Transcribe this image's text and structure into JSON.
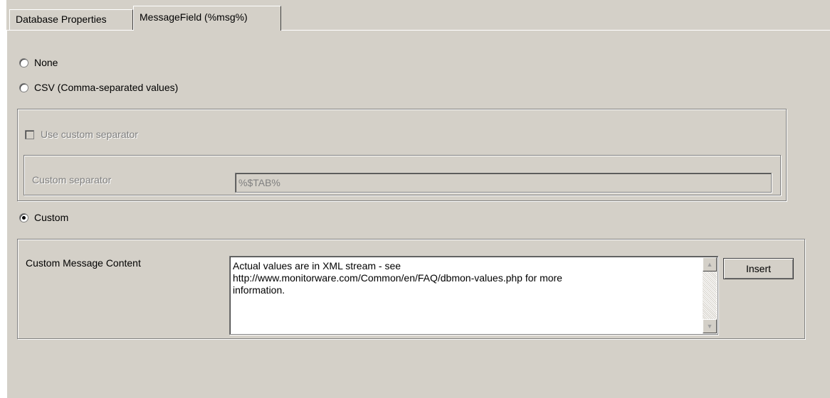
{
  "tabs": [
    {
      "label": "Database Properties",
      "active": false
    },
    {
      "label": "MessageField (%msg%)",
      "active": true
    }
  ],
  "format_options": {
    "none_label": "None",
    "csv_label": "CSV (Comma-separated values)",
    "custom_label": "Custom",
    "selected": "Custom"
  },
  "csv_group": {
    "use_custom_separator_label": "Use custom separator",
    "use_custom_separator_checked": false,
    "custom_separator_label": "Custom separator",
    "custom_separator_value": "%$TAB%"
  },
  "custom_group": {
    "label": "Custom Message Content",
    "content": "Actual values are in XML stream - see\nhttp://www.monitorware.com/Common/en/FAQ/dbmon-values.php for more\ninformation.",
    "insert_label": "Insert"
  },
  "icons": {
    "scroll_up": "scroll-up-arrow",
    "scroll_down": "scroll-down-arrow"
  }
}
